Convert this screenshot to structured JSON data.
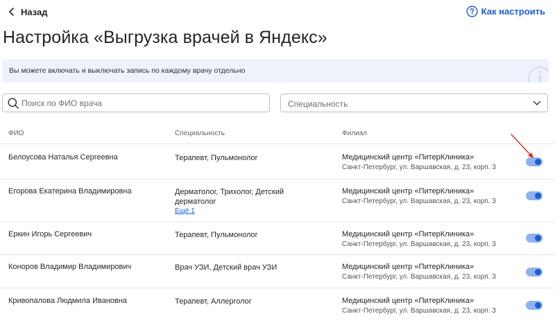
{
  "header": {
    "back_label": "Назад",
    "help_label": "Как настроить"
  },
  "page": {
    "title": "Настройка «Выгрузка врачей в Яндекс»"
  },
  "info": {
    "text": "Вы можете включать и выключать запись по каждому врачу отдельно"
  },
  "filters": {
    "search_placeholder": "Поиск по ФИО врача",
    "search_value": "",
    "specialty_placeholder": "Специальность"
  },
  "table": {
    "columns": [
      "ФИО",
      "Специальность",
      "Филиал"
    ],
    "rows": [
      {
        "name": "Белоусова Наталья Сергеевна",
        "specialty": "Терапевт, Пульмонолог",
        "more": "",
        "branch_name": "Медицинский центр «ПитерКлиника»",
        "branch_address": "Санкт-Петербург, ул. Варшавская, д. 23, корп. 3",
        "enabled": true
      },
      {
        "name": "Егорова Екатерина Владимировна",
        "specialty": "Дерматолог, Трихолог, Детский дерматолог",
        "more": "Ещё 1",
        "branch_name": "Медицинский центр «ПитерКлиника»",
        "branch_address": "Санкт-Петербург, ул. Варшавская, д. 23, корп. 3",
        "enabled": true
      },
      {
        "name": "Еркин Игорь Сергеевич",
        "specialty": "Терапевт, Пульмонолог",
        "more": "",
        "branch_name": "Медицинский центр «ПитерКлиника»",
        "branch_address": "Санкт-Петербург, ул. Варшавская, д. 23, корп. 3",
        "enabled": true
      },
      {
        "name": "Коноров Владимир Владимирович",
        "specialty": "Врач УЗИ, Детский врач УЗИ",
        "more": "",
        "branch_name": "Медицинский центр «ПитерКлиника»",
        "branch_address": "Санкт-Петербург, ул. Варшавская, д. 23, корп. 3",
        "enabled": true
      },
      {
        "name": "Кривопалова Людмила Ивановна",
        "specialty": "Терапевт, Аллерголог",
        "more": "",
        "branch_name": "Медицинский центр «ПитерКлиника»",
        "branch_address": "Санкт-Петербург, ул. Варшавская, д. 23, корп. 3",
        "enabled": true
      }
    ]
  },
  "icons": {
    "back": "chevron-left-icon",
    "help": "question-circle-icon",
    "info_watermark": "info-icon",
    "search": "search-icon",
    "dropdown": "chevron-down-icon",
    "annotation": "red-arrow-icon"
  },
  "colors": {
    "accent": "#1a5bd7",
    "toggle_track": "#8fb2ef",
    "info_bg": "#eef2fb",
    "annotation": "#e8261c"
  }
}
